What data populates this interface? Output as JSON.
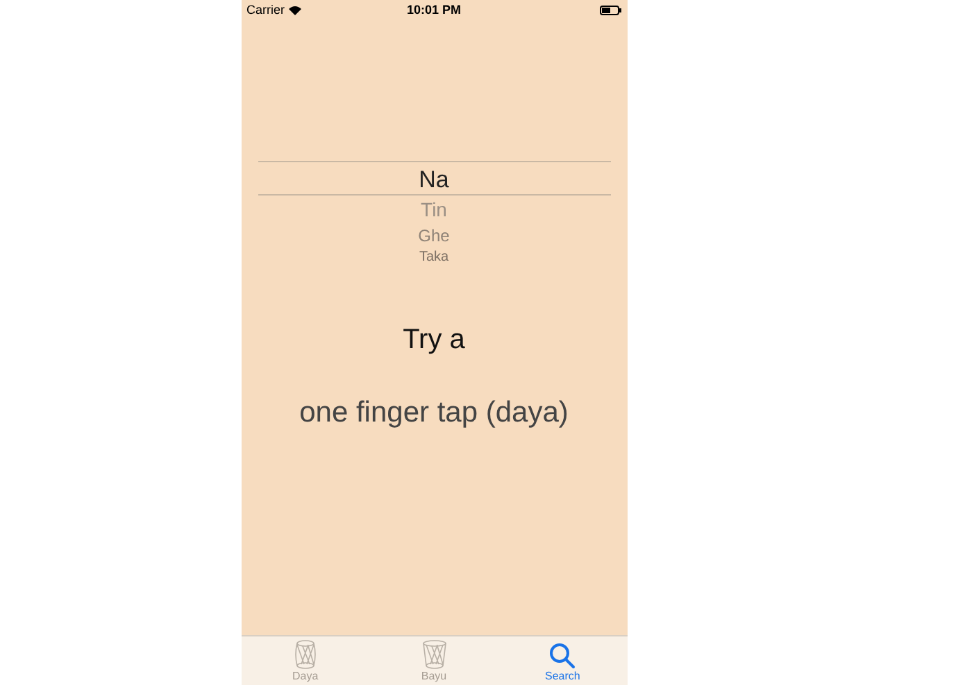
{
  "status_bar": {
    "carrier": "Carrier",
    "time": "10:01 PM"
  },
  "picker": {
    "items": [
      {
        "label": "Na",
        "selected": true
      },
      {
        "label": "Tin",
        "selected": false
      },
      {
        "label": "Ghe",
        "selected": false
      },
      {
        "label": "Taka",
        "selected": false
      }
    ]
  },
  "prompt": {
    "title": "Try a",
    "instruction": "one finger tap (daya)"
  },
  "tab_bar": {
    "tabs": [
      {
        "label": "Daya",
        "kind": "drum",
        "selected": false
      },
      {
        "label": "Bayu",
        "kind": "drum",
        "selected": false
      },
      {
        "label": "Search",
        "kind": "search",
        "selected": true
      }
    ]
  }
}
